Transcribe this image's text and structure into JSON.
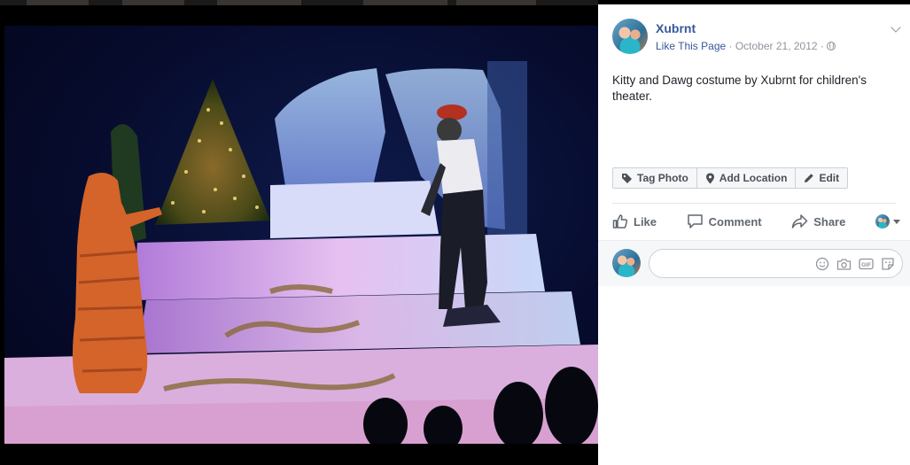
{
  "post": {
    "page_name": "Xubrnt",
    "like_page_label": "Like This Page",
    "separator": " · ",
    "date": "October 21, 2012",
    "caption": "Kitty and Dawg costume by Xubrnt for children's theater."
  },
  "photo_actions": {
    "tag_label": "Tag Photo",
    "location_label": "Add Location",
    "edit_label": "Edit"
  },
  "reactions": {
    "like_label": "Like",
    "comment_label": "Comment",
    "share_label": "Share"
  },
  "colors": {
    "link": "#365899",
    "meta": "#90949c",
    "action_text": "#606770",
    "panel_bg": "#ffffff",
    "viewer_bg": "#000000"
  },
  "icons": [
    "tag-icon",
    "pin-icon",
    "pencil-icon",
    "thumbs-up-icon",
    "speech-bubble-icon",
    "share-arrow-icon",
    "smiley-icon",
    "camera-icon",
    "gif-icon",
    "sticker-icon",
    "globe-icon",
    "chevron-down-icon"
  ]
}
